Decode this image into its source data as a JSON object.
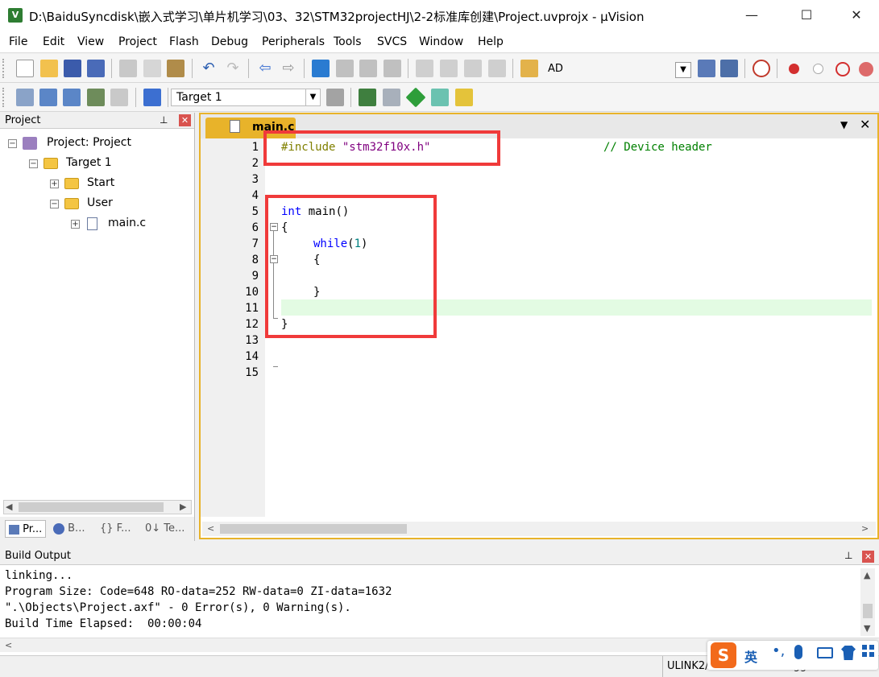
{
  "window": {
    "title": "D:\\BaiduSyncdisk\\嵌入式学习\\单片机学习\\03、32\\STM32projectHJ\\2-2标准库创建\\Project.uvprojx - µVision",
    "minimize": "—",
    "maximize": "☐",
    "close": "✕"
  },
  "menu": [
    "File",
    "Edit",
    "View",
    "Project",
    "Flash",
    "Debug",
    "Peripherals",
    "Tools",
    "SVCS",
    "Window",
    "Help"
  ],
  "toolbar": {
    "ad_label": "AD",
    "target_select": "Target 1"
  },
  "project_panel": {
    "title": "Project",
    "tree": {
      "root": "Project: Project",
      "target": "Target 1",
      "group_start": "Start",
      "group_user": "User",
      "file_main": "main.c"
    },
    "bottom_tabs": [
      "Pr...",
      "B...",
      "{} F...",
      "0↓ Te..."
    ]
  },
  "editor": {
    "tab_label": "main.c",
    "line_numbers": [
      "1",
      "2",
      "3",
      "4",
      "5",
      "6",
      "7",
      "8",
      "9",
      "10",
      "11",
      "12",
      "13",
      "14",
      "15"
    ],
    "lines": {
      "l1_directive": "#include",
      "l1_string": "\"stm32f10x.h\"",
      "l1_comment": "// Device header",
      "l5_kw": "int",
      "l5_rest": " main()",
      "l6": "{",
      "l7_kw": "while",
      "l7_open": "(",
      "l7_num": "1",
      "l7_close": ")",
      "l8": "{",
      "l10": "}",
      "l12": "}"
    }
  },
  "build_output": {
    "title": "Build Output",
    "lines": [
      "linking...",
      "Program Size: Code=648 RO-data=252 RW-data=0 ZI-data=1632",
      "\".\\Objects\\Project.axf\" - 0 Error(s), 0 Warning(s).",
      "Build Time Elapsed:  00:00:04"
    ]
  },
  "status_bar": {
    "debugger": "ULINK2/ME Cortex Debugger"
  },
  "ime": {
    "logo": "S",
    "mode": "英"
  },
  "colors": {
    "highlight_box": "#f03a3a",
    "editor_border": "#e8b32a",
    "current_line": "#e3fbe3"
  }
}
